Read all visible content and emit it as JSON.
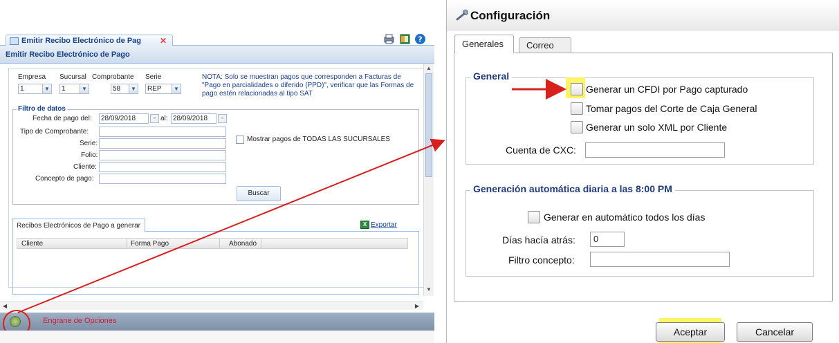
{
  "left_app": {
    "doc_tab_label": "Emitir Recibo Electrónico de Pag",
    "doc_tab_close": "✕",
    "title": "Emitir Recibo Electrónico de Pago",
    "filters": {
      "empresa_label": "Empresa",
      "empresa_value": "1",
      "sucursal_label": "Sucursal",
      "sucursal_value": "1",
      "comprobante_label": "Comprobante",
      "comprobante_value": "58",
      "serie_label": "Serie",
      "serie_value": "REP",
      "nota": "NOTA: Solo se muestran pagos que corresponden a Facturas de \"Pago en parcialidades o diferido (PPD)\", verificar que las Formas de pago estén relacionadas al tipo SAT"
    },
    "filtro": {
      "title": "Filtro de datos",
      "fecha_label": "Fecha de pago del:",
      "fecha_del": "28/09/2018",
      "al_label": "al:",
      "fecha_al": "28/09/2018",
      "tipo_label": "Tipo de Comprobante:",
      "serie_label": "Serie:",
      "folio_label": "Folio:",
      "cliente_label": "Cliente:",
      "concepto_label": "Concepto de pago:",
      "mostrar_label": "Mostrar pagos de TODAS LAS SUCURSALES",
      "buscar_label": "Buscar"
    },
    "grid": {
      "tab_label": "Recibos Electrónicos de Pago a generar",
      "export_label": "Exportar",
      "columns": [
        "Cliente",
        "Forma Pago",
        "Abonado"
      ]
    },
    "bottom": {
      "gear_label": "Engrane de Opciones"
    }
  },
  "dialog": {
    "title": "Configuración",
    "tabs": [
      "Generales",
      "Correo"
    ],
    "general": {
      "title": "General",
      "options": [
        "Generar un CFDI por Pago capturado",
        "Tomar pagos del Corte de Caja General",
        "Generar un solo XML por Cliente"
      ],
      "cuenta_label": "Cuenta de CXC:",
      "cuenta_value": ""
    },
    "auto": {
      "title": "Generación automática diaria a las 8:00 PM",
      "option": "Generar en automático todos los días",
      "dias_label": "Días hacía atrás:",
      "dias_value": "0",
      "filtro_label": "Filtro concepto:",
      "filtro_value": ""
    },
    "buttons": {
      "accept": "Aceptar",
      "cancel": "Cancelar"
    }
  },
  "colors": {
    "highlight": "#fbf24a",
    "arrow_red": "#d8201c",
    "ext_blue": "#15428b"
  }
}
